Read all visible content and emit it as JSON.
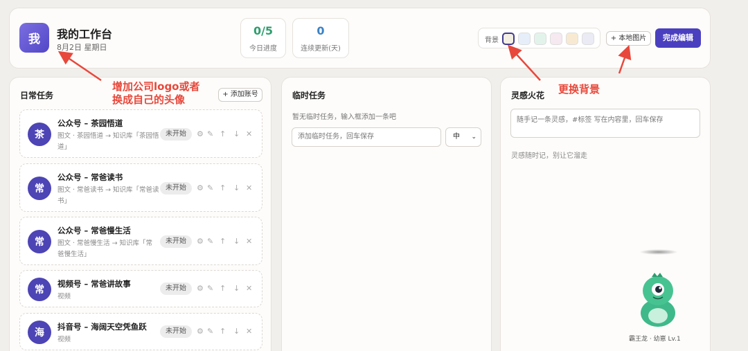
{
  "header": {
    "logo_char": "我",
    "title": "我的工作台",
    "date": "8月2日 星期日",
    "stats": [
      {
        "value": "0/5",
        "label": "今日进度",
        "color": "#2f9e6e"
      },
      {
        "value": "0",
        "label": "连续更新(天)",
        "color": "#3b82c4"
      }
    ],
    "bg_label": "背景",
    "swatches": [
      "#f3efe4",
      "#e6eefa",
      "#e2f3ec",
      "#f6e9f0",
      "#f8ead2",
      "#ebebf5"
    ],
    "local_image_btn": "+ 本地图片",
    "done_btn": "完成编辑"
  },
  "daily": {
    "title": "日常任务",
    "add_btn": "+ 添加账号",
    "tasks": [
      {
        "avatar": "茶",
        "name": "公众号 – 茶园悟道",
        "sub": "图文 · 茶园悟道 → 知识库「茶园悟道」",
        "status": "未开始"
      },
      {
        "avatar": "常",
        "name": "公众号 – 常爸读书",
        "sub": "图文 · 常爸读书 → 知识库「常爸读书」",
        "status": "未开始"
      },
      {
        "avatar": "常",
        "name": "公众号 – 常爸慢生活",
        "sub": "图文 · 常爸慢生活 → 知识库「常爸慢生活」",
        "status": "未开始"
      },
      {
        "avatar": "常",
        "name": "视频号 – 常爸讲故事",
        "sub": "视频",
        "status": "未开始"
      },
      {
        "avatar": "海",
        "name": "抖音号 – 海阔天空凭鱼跃",
        "sub": "视频",
        "status": "未开始"
      }
    ]
  },
  "temp": {
    "title": "临时任务",
    "hint": "暂无临时任务，输入框添加一条吧",
    "input_placeholder": "添加临时任务，回车保存",
    "priority": "中"
  },
  "inspiration": {
    "title": "灵感火花",
    "placeholder": "随手记一条灵感，#标签 写在内容里，回车保存",
    "note": "灵感随时记，别让它溜走",
    "pet_label": "霸王龙 · 幼崽 Lv.1"
  },
  "annotations": {
    "logo_tip": "增加公司logo或者\n换成自己的头像",
    "bg_tip": "更换背景",
    "color": "#e8483b"
  }
}
